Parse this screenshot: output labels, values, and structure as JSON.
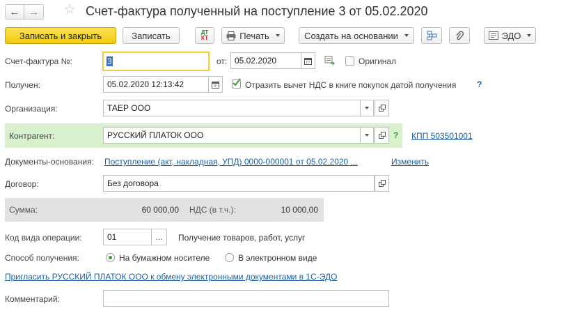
{
  "title": "Счет-фактура полученный на поступление 3 от 05.02.2020",
  "toolbar": {
    "save_close": "Записать и закрыть",
    "save": "Записать",
    "dtkt_top": "ДТ",
    "dtkt_bottom": "КТ",
    "print": "Печать",
    "create_based": "Создать на основании",
    "edo": "ЭДО"
  },
  "form": {
    "invoice_no_label": "Счет-фактура №:",
    "invoice_no_value": "3",
    "from_label": "от:",
    "from_value": "05.02.2020",
    "original_label": "Оригинал",
    "received_label": "Получен:",
    "received_value": "05.02.2020 12:13:42",
    "vat_checkbox_label": "Отразить вычет НДС в книге покупок датой получения",
    "help": "?",
    "org_label": "Организация:",
    "org_value": "ТАЕР ООО",
    "counterparty_label": "Контрагент:",
    "counterparty_value": "РУССКИЙ ПЛАТОК ООО",
    "kpp_link": "КПП 503501001",
    "docs_label": "Документы-основания:",
    "docs_link": "Поступление (акт, накладная, УПД) 0000-000001 от 05.02.2020 ...",
    "change_link": "Изменить",
    "contract_label": "Договор:",
    "contract_value": "Без договора",
    "sum_label": "Сумма:",
    "sum_value": "60 000,00",
    "vat_label": "НДС (в т.ч.):",
    "vat_value": "10 000,00",
    "op_code_label": "Код вида операции:",
    "op_code_value": "01",
    "op_code_desc": "Получение товаров, работ, услуг",
    "receipt_method_label": "Способ получения:",
    "receipt_paper": "На бумажном носителе",
    "receipt_electronic": "В электронном виде",
    "invite_link": "Пригласить РУССКИЙ ПЛАТОК ООО к обмену электронными документами в 1С-ЭДО",
    "comment_label": "Комментарий:",
    "comment_value": ""
  },
  "colors": {
    "primary_button": "#f2cb0c",
    "link": "#1a5fa8",
    "highlight_row": "#d9f0cd",
    "sum_row": "#e2e2e2"
  }
}
